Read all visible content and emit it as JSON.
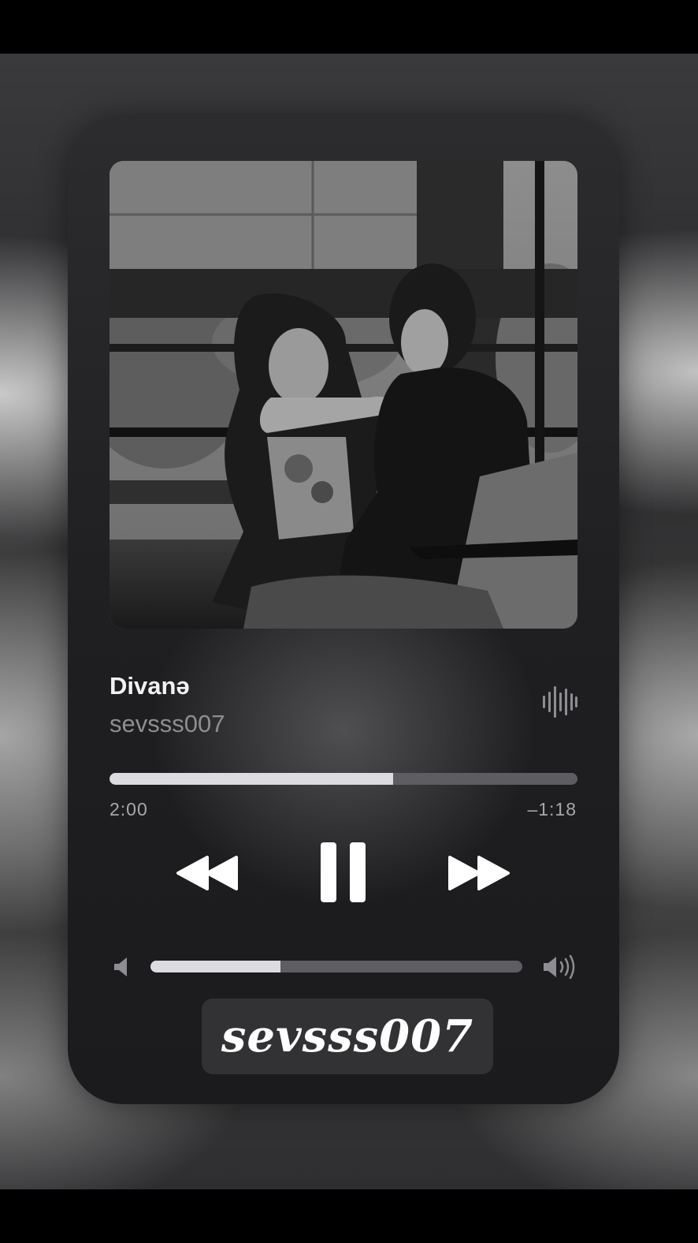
{
  "track": {
    "title": "Divanə",
    "artist": "sevsss007"
  },
  "playback": {
    "elapsed": "2:00",
    "remaining": "–1:18",
    "progress_fraction": 0.606,
    "state": "playing"
  },
  "volume": {
    "level_fraction": 0.35
  },
  "watermark": {
    "text": "sevsss007"
  },
  "icons": {
    "waveform": "waveform-icon",
    "rewind": "rewind-icon",
    "pause": "pause-icon",
    "forward": "fast-forward-icon",
    "volume_low": "volume-low-icon",
    "volume_high": "volume-high-icon"
  },
  "colors": {
    "progress_fill": "#dcdce0",
    "track_bg": "#5e5e62",
    "card_bg": "#1f1f21"
  }
}
